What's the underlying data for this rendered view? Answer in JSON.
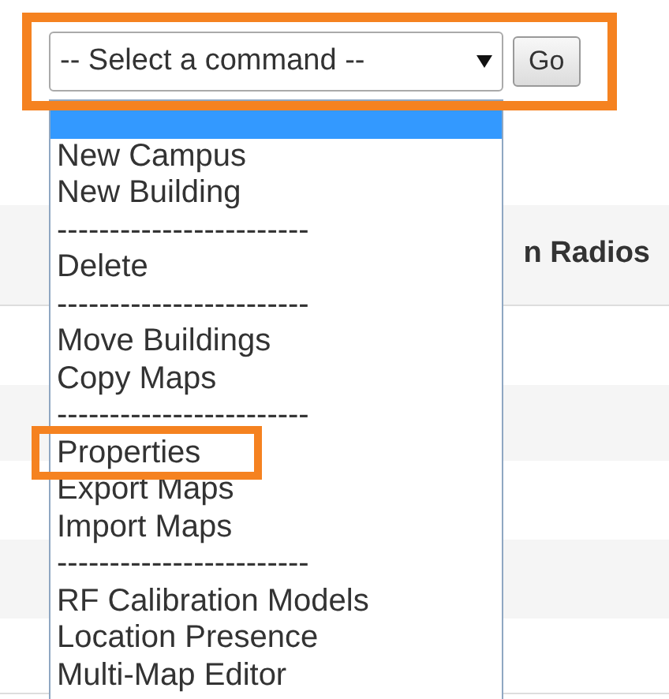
{
  "command_select": {
    "value": "-- Select a command --",
    "button": "Go",
    "highlighted": true
  },
  "dropdown": {
    "options": [
      {
        "kind": "option",
        "selected": true
      },
      {
        "kind": "option",
        "label": "New Campus",
        "selected": false
      },
      {
        "kind": "option",
        "label": "New Building",
        "selected": false
      },
      {
        "kind": "separator",
        "label": "------------------------"
      },
      {
        "kind": "option",
        "label": "Delete",
        "selected": false
      },
      {
        "kind": "separator",
        "label": "------------------------"
      },
      {
        "kind": "option",
        "label": "Move Buildings",
        "selected": false
      },
      {
        "kind": "option",
        "label": "Copy Maps",
        "selected": false
      },
      {
        "kind": "separator",
        "label": "------------------------"
      },
      {
        "kind": "option",
        "label": "Properties",
        "selected": false,
        "highlighted": true
      },
      {
        "kind": "option",
        "label": "Export Maps",
        "selected": false
      },
      {
        "kind": "option",
        "label": "Import Maps",
        "selected": false
      },
      {
        "kind": "separator",
        "label": "------------------------"
      },
      {
        "kind": "option",
        "label": "RF Calibration Models",
        "selected": false
      },
      {
        "kind": "option",
        "label": "Location Presence",
        "selected": false
      },
      {
        "kind": "option",
        "label": "Multi-Map Editor",
        "selected": false
      }
    ]
  },
  "table": {
    "columns": [
      "n Radios"
    ]
  }
}
